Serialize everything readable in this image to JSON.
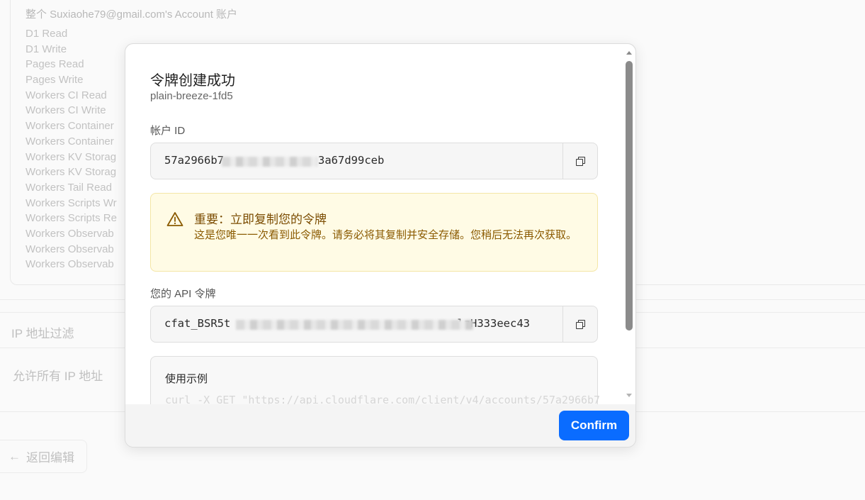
{
  "background": {
    "account_header": "整个 Suxiaohe79@gmail.com's Account 账户",
    "permissions": [
      "D1 Read",
      "D1 Write",
      "Pages Read",
      "Pages Write",
      "Workers CI Read",
      "Workers CI Write",
      "Workers Container",
      "Workers Container",
      "Workers KV Storag",
      "Workers KV Storag",
      "Workers Tail Read",
      "Workers Scripts Wr",
      "Workers Scripts Re",
      "Workers Observab",
      "Workers Observab",
      "Workers Observab"
    ],
    "ip_filter_title": "IP 地址过滤",
    "ip_filter_value": "允许所有 IP 地址",
    "back_label": "返回编辑"
  },
  "modal": {
    "title": "令牌创建成功",
    "token_name": "plain-breeze-1fd5",
    "account_id_label": "帐户 ID",
    "account_id_start": "57a2966b7",
    "account_id_end": "3a67d99ceb",
    "warning_title": "重要：立即复制您的令牌",
    "warning_text": "这是您唯一一次看到此令牌。请务必将其复制并安全存储。您稍后无法再次获取。",
    "api_token_label": "您的 API 令牌",
    "api_token_start": "cfat_BSR5t",
    "api_token_end": "lzH333eec43",
    "example_title": "使用示例",
    "example_code": "curl -X GET \"https://api.cloudflare.com/client/v4/accounts/57a2966b7",
    "confirm_label": "Confirm"
  },
  "colors": {
    "primary": "#0a6cff",
    "warning_bg": "#fffbe5",
    "warning_text": "#8a5a00"
  }
}
